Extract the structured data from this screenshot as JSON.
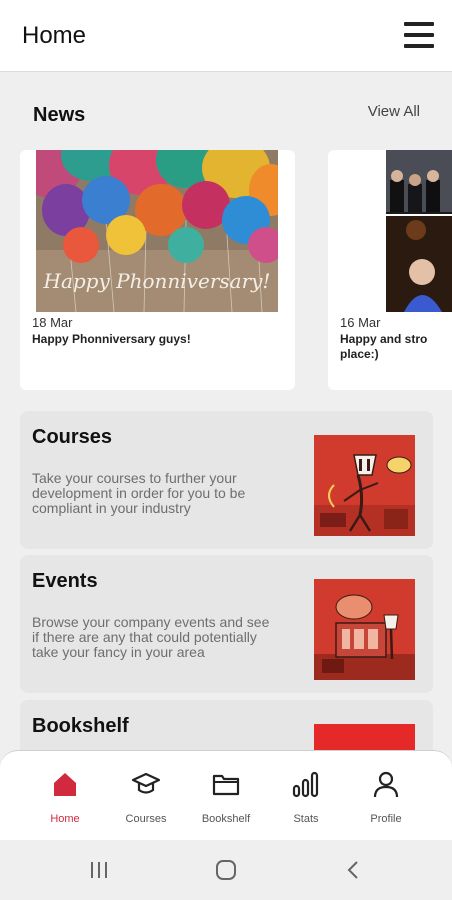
{
  "header": {
    "title": "Home"
  },
  "news": {
    "title": "News",
    "view_all": "View All",
    "items": [
      {
        "date": "18 Mar",
        "caption": "Happy Phonniversary guys!",
        "image_text": "Happy Phonniversary!"
      },
      {
        "date": "16 Mar",
        "caption_line1": "Happy and stro",
        "caption_line2": "place:)"
      }
    ]
  },
  "features": [
    {
      "title": "Courses",
      "description": "Take your courses to further your development in order for you to be compliant in your industry"
    },
    {
      "title": "Events",
      "description": "Browse your company events and see if there are any that could potentially take your fancy in your area"
    },
    {
      "title": "Bookshelf"
    }
  ],
  "bottom_nav": [
    {
      "label": "Home",
      "icon": "home-icon",
      "active": true
    },
    {
      "label": "Courses",
      "icon": "graduation-cap-icon"
    },
    {
      "label": "Bookshelf",
      "icon": "folder-icon"
    },
    {
      "label": "Stats",
      "icon": "bar-chart-icon"
    },
    {
      "label": "Profile",
      "icon": "user-icon"
    }
  ],
  "colors": {
    "accent": "#d12a3e",
    "card_bg": "#e6e6e6",
    "page_bg": "#efefef",
    "illustration_red": "#d03b2d"
  }
}
